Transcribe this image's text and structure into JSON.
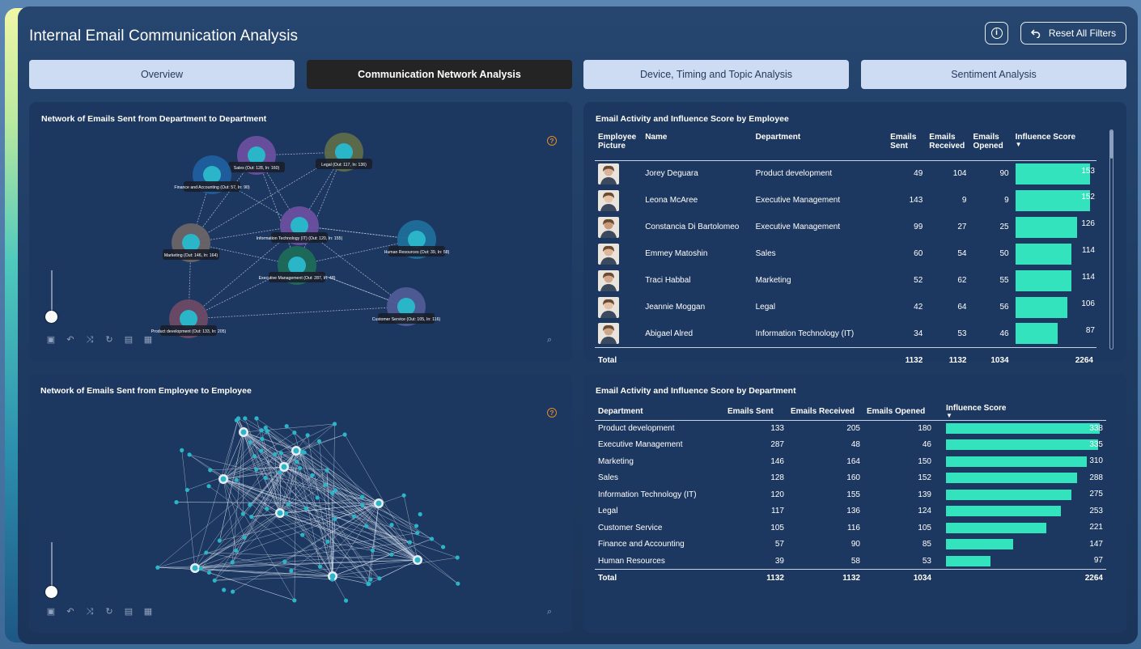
{
  "app": {
    "title": "Internal Email Communication Analysis",
    "reset_label": "Reset All Filters",
    "info_glyph": "i"
  },
  "tabs": [
    {
      "label": "Overview",
      "active": false
    },
    {
      "label": "Communication Network Analysis",
      "active": true
    },
    {
      "label": "Device, Timing and Topic Analysis",
      "active": false
    },
    {
      "label": "Sentiment Analysis",
      "active": false
    }
  ],
  "dept_network": {
    "title": "Network of Emails Sent from Department to Department",
    "nodes": [
      {
        "label": "Sales (Out: 128, In: 160)",
        "color": "#6a4fa0"
      },
      {
        "label": "Legal (Out: 117, In: 136)",
        "color": "#5f6b4a"
      },
      {
        "label": "Finance and Accounting (Out: 57, In: 90)",
        "color": "#1f5e9e"
      },
      {
        "label": "Information Technology (IT) (Out: 120, In: 155)",
        "color": "#6a4fa0"
      },
      {
        "label": "Marketing (Out: 146, In: 164)",
        "color": "#6b6466"
      },
      {
        "label": "Human Resources (Out: 39, In: 58)",
        "color": "#1f6e9a"
      },
      {
        "label": "Executive Management (Out: 287, In: 48)",
        "color": "#1f6a5a"
      },
      {
        "label": "Customer Service (Out: 105, In: 116)",
        "color": "#4f5b96"
      },
      {
        "label": "Product development (Out: 133, In: 205)",
        "color": "#6b4a66"
      }
    ]
  },
  "emp_network": {
    "title": "Network of Emails Sent from Employee to Employee"
  },
  "toolbar_icons": [
    "camera-icon",
    "undo-icon",
    "shuffle-icon",
    "refresh-icon",
    "save-icon",
    "grid-icon"
  ],
  "employee_table": {
    "title": "Email Activity and Influence Score by Employee",
    "headers": {
      "picture": "Employee Picture",
      "name": "Name",
      "department": "Department",
      "sent": "Emails Sent",
      "received": "Emails Received",
      "opened": "Emails Opened",
      "influence": "Influence Score"
    },
    "rows": [
      {
        "name": "Jorey Deguara",
        "department": "Product development",
        "sent": "49",
        "received": "104",
        "opened": "90",
        "influence": 153
      },
      {
        "name": "Leona McAree",
        "department": "Executive Management",
        "sent": "143",
        "received": "9",
        "opened": "9",
        "influence": 152
      },
      {
        "name": "Constancia Di Bartolomeo",
        "department": "Executive Management",
        "sent": "99",
        "received": "27",
        "opened": "25",
        "influence": 126
      },
      {
        "name": "Emmey Matoshin",
        "department": "Sales",
        "sent": "60",
        "received": "54",
        "opened": "50",
        "influence": 114
      },
      {
        "name": "Traci Habbal",
        "department": "Marketing",
        "sent": "52",
        "received": "62",
        "opened": "55",
        "influence": 114
      },
      {
        "name": "Jeannie Moggan",
        "department": "Legal",
        "sent": "42",
        "received": "64",
        "opened": "56",
        "influence": 106
      },
      {
        "name": "Abigael Alred",
        "department": "Information Technology (IT)",
        "sent": "34",
        "received": "53",
        "opened": "46",
        "influence": 87
      }
    ],
    "total": {
      "label": "Total",
      "sent": "1132",
      "received": "1132",
      "opened": "1034",
      "influence": "2264"
    }
  },
  "department_table": {
    "title": "Email Activity and Influence Score by Department",
    "headers": {
      "department": "Department",
      "sent": "Emails Sent",
      "received": "Emails Received",
      "opened": "Emails Opened",
      "influence": "Influence Score"
    },
    "rows": [
      {
        "department": "Product development",
        "sent": "133",
        "received": "205",
        "opened": "180",
        "influence": 338
      },
      {
        "department": "Executive Management",
        "sent": "287",
        "received": "48",
        "opened": "46",
        "influence": 335
      },
      {
        "department": "Marketing",
        "sent": "146",
        "received": "164",
        "opened": "150",
        "influence": 310
      },
      {
        "department": "Sales",
        "sent": "128",
        "received": "160",
        "opened": "152",
        "influence": 288
      },
      {
        "department": "Information Technology (IT)",
        "sent": "120",
        "received": "155",
        "opened": "139",
        "influence": 275
      },
      {
        "department": "Legal",
        "sent": "117",
        "received": "136",
        "opened": "124",
        "influence": 253
      },
      {
        "department": "Customer Service",
        "sent": "105",
        "received": "116",
        "opened": "105",
        "influence": 221
      },
      {
        "department": "Finance and Accounting",
        "sent": "57",
        "received": "90",
        "opened": "85",
        "influence": 147
      },
      {
        "department": "Human Resources",
        "sent": "39",
        "received": "58",
        "opened": "53",
        "influence": 97
      }
    ],
    "total": {
      "label": "Total",
      "sent": "1132",
      "received": "1132",
      "opened": "1034",
      "influence": "2264"
    }
  },
  "colors": {
    "bar": "#33e3bd",
    "node_core": "#2bb5c8"
  }
}
